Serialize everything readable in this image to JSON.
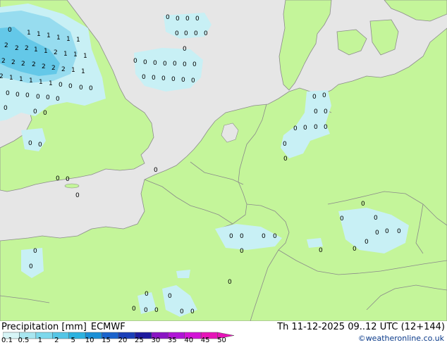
{
  "header": {
    "product_label": "Precipitation [mm]",
    "model_label": "ECMWF",
    "datetime_label": "Th 11-12-2025 09..12 UTC (12+144)",
    "credit": "©weatheronline.co.uk"
  },
  "colors": {
    "sea": "#e6e6e6",
    "land": "#c4f59a",
    "border": "#8a8a8a",
    "coast": "#8c8c8c",
    "precip_light": "#c8f0f5",
    "precip_mid": "#97dcef",
    "precip_strong": "#64c8e8"
  },
  "legend": {
    "values": [
      "0.1",
      "0.5",
      "1",
      "2",
      "5",
      "10",
      "15",
      "20",
      "25",
      "30",
      "35",
      "40",
      "45",
      "50"
    ],
    "swatches": [
      "#d7f5f7",
      "#a8e6f0",
      "#7dd8ec",
      "#55c6e6",
      "#2db2df",
      "#1a8fd6",
      "#1a63cc",
      "#1a3fb8",
      "#1e1a9e",
      "#8a14c4",
      "#b014d6",
      "#d214d6",
      "#e614b8"
    ]
  },
  "map": {
    "value_labels": [
      {
        "id": "gb-1",
        "text": "0"
      },
      {
        "id": "gb-2",
        "text": "1"
      },
      {
        "id": "gb-3",
        "text": "1"
      },
      {
        "id": "gb-4",
        "text": "1"
      },
      {
        "id": "gb-5",
        "text": "1"
      },
      {
        "id": "gb-6",
        "text": "1"
      },
      {
        "id": "gb-7",
        "text": "1"
      },
      {
        "id": "gb-8",
        "text": "2"
      },
      {
        "id": "gb-9",
        "text": "2"
      },
      {
        "id": "gb-10",
        "text": "2"
      },
      {
        "id": "gb-11",
        "text": "1"
      },
      {
        "id": "gb-12",
        "text": "1"
      },
      {
        "id": "gb-13",
        "text": "2"
      },
      {
        "id": "gb-14",
        "text": "1"
      },
      {
        "id": "gb-15",
        "text": "1"
      },
      {
        "id": "gb-16",
        "text": "1"
      },
      {
        "id": "gb-17",
        "text": "2"
      },
      {
        "id": "gb-18",
        "text": "2"
      },
      {
        "id": "gb-19",
        "text": "2"
      },
      {
        "id": "gb-20",
        "text": "2"
      },
      {
        "id": "gb-21",
        "text": "2"
      },
      {
        "id": "gb-22",
        "text": "2"
      },
      {
        "id": "gb-23",
        "text": "2"
      },
      {
        "id": "gb-24",
        "text": "1"
      },
      {
        "id": "gb-25",
        "text": "1"
      },
      {
        "id": "gb-26",
        "text": "2"
      },
      {
        "id": "gb-27",
        "text": "1"
      },
      {
        "id": "gb-28",
        "text": "1"
      },
      {
        "id": "gb-29",
        "text": "1"
      },
      {
        "id": "gb-30",
        "text": "1"
      },
      {
        "id": "gb-31",
        "text": "1"
      },
      {
        "id": "gb-32",
        "text": "0"
      },
      {
        "id": "gb-33",
        "text": "0"
      },
      {
        "id": "gb-34",
        "text": "0"
      },
      {
        "id": "gb-35",
        "text": "0"
      },
      {
        "id": "gb-36",
        "text": "0"
      },
      {
        "id": "gb-37",
        "text": "0"
      },
      {
        "id": "gb-38",
        "text": "0"
      },
      {
        "id": "gb-39",
        "text": "0"
      },
      {
        "id": "gb-40",
        "text": "0"
      },
      {
        "id": "gb-41",
        "text": "0"
      },
      {
        "id": "gb-42",
        "text": "0"
      },
      {
        "id": "gb-43",
        "text": "0"
      },
      {
        "id": "gb-44",
        "text": "0"
      },
      {
        "id": "gb-45",
        "text": "0"
      },
      {
        "id": "gb-46",
        "text": "0"
      },
      {
        "id": "gb-47",
        "text": "0"
      },
      {
        "id": "gb-48",
        "text": "0"
      },
      {
        "id": "gb-49",
        "text": "0"
      },
      {
        "id": "gb-50",
        "text": "0"
      },
      {
        "id": "ns-1",
        "text": "0"
      },
      {
        "id": "ns-2",
        "text": "0"
      },
      {
        "id": "ns-3",
        "text": "0"
      },
      {
        "id": "ns-4",
        "text": "0"
      },
      {
        "id": "ns-5",
        "text": "0"
      },
      {
        "id": "ns-6",
        "text": "0"
      },
      {
        "id": "ns-7",
        "text": "0"
      },
      {
        "id": "ns-8",
        "text": "0"
      },
      {
        "id": "ns-9",
        "text": "0"
      },
      {
        "id": "ns-10",
        "text": "0"
      },
      {
        "id": "ns-11",
        "text": "0"
      },
      {
        "id": "ns-12",
        "text": "0"
      },
      {
        "id": "ns-13",
        "text": "0"
      },
      {
        "id": "ns-14",
        "text": "0"
      },
      {
        "id": "ns-15",
        "text": "0"
      },
      {
        "id": "ns-16",
        "text": "0"
      },
      {
        "id": "ns-17",
        "text": "0"
      },
      {
        "id": "ns-18",
        "text": "0"
      },
      {
        "id": "ns-19",
        "text": "0"
      },
      {
        "id": "ns-20",
        "text": "0"
      },
      {
        "id": "ns-21",
        "text": "0"
      },
      {
        "id": "ns-22",
        "text": "0"
      },
      {
        "id": "ns-23",
        "text": "0"
      },
      {
        "id": "ns-24",
        "text": "0"
      },
      {
        "id": "de-1",
        "text": "0"
      },
      {
        "id": "de-2",
        "text": "0"
      },
      {
        "id": "de-3",
        "text": "0"
      },
      {
        "id": "de-4",
        "text": "0"
      },
      {
        "id": "de-5",
        "text": "0"
      },
      {
        "id": "de-6",
        "text": "0"
      },
      {
        "id": "de-7",
        "text": "0"
      },
      {
        "id": "de-8",
        "text": "0"
      },
      {
        "id": "de-9",
        "text": "0"
      },
      {
        "id": "fr-1",
        "text": "0"
      },
      {
        "id": "fr-2",
        "text": "0"
      },
      {
        "id": "lu-1",
        "text": "0"
      },
      {
        "id": "lu-2",
        "text": "0"
      },
      {
        "id": "lu-3",
        "text": "0"
      },
      {
        "id": "lu-4",
        "text": "0"
      },
      {
        "id": "lu-5",
        "text": "0"
      },
      {
        "id": "cz-1",
        "text": "0"
      },
      {
        "id": "cz-2",
        "text": "0"
      },
      {
        "id": "cz-3",
        "text": "0"
      },
      {
        "id": "cz-4",
        "text": "0"
      },
      {
        "id": "cz-5",
        "text": "0"
      },
      {
        "id": "cz-6",
        "text": "0"
      },
      {
        "id": "cz-7",
        "text": "0"
      },
      {
        "id": "cz-8",
        "text": "0"
      },
      {
        "id": "fr-3",
        "text": "0"
      },
      {
        "id": "fr-4",
        "text": "0"
      },
      {
        "id": "fr-5",
        "text": "0"
      },
      {
        "id": "fr-6",
        "text": "0"
      },
      {
        "id": "fr-7",
        "text": "0"
      },
      {
        "id": "fr-8",
        "text": "0"
      },
      {
        "id": "fr-9",
        "text": "0"
      },
      {
        "id": "fr-10",
        "text": "0"
      }
    ]
  }
}
